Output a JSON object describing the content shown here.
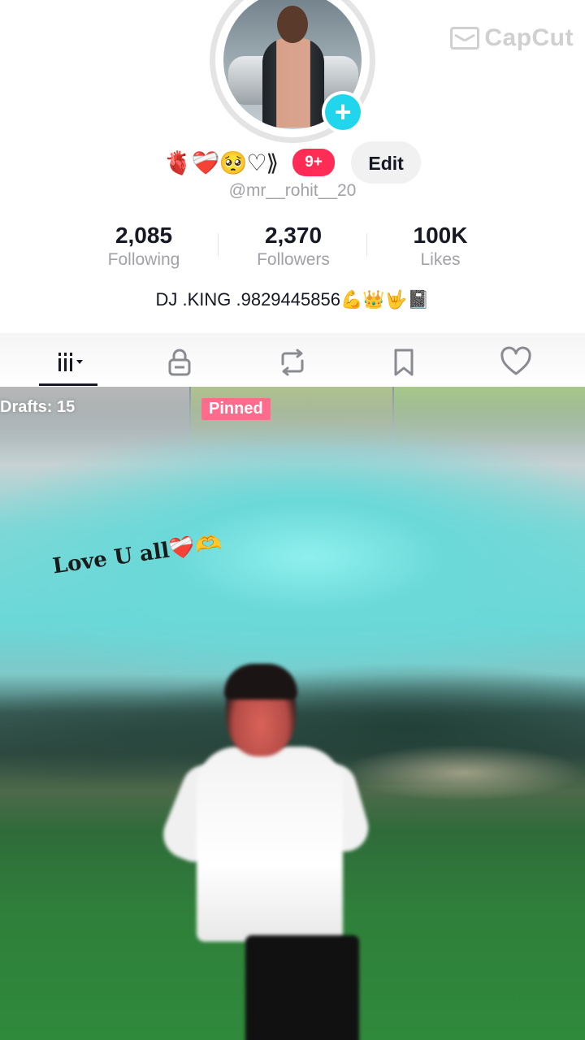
{
  "watermark": {
    "text": "CapCut"
  },
  "profile": {
    "avatar_alt": "profile photo",
    "add_icon": "plus-icon",
    "name_emojis": "🫀❤️‍🩹🥺♡⟫",
    "notification_badge": "9+",
    "edit_label": "Edit",
    "handle": "@mr__rohit__20",
    "stats": [
      {
        "value": "2,085",
        "label": "Following"
      },
      {
        "value": "2,370",
        "label": "Followers"
      },
      {
        "value": "100K",
        "label": "Likes"
      }
    ],
    "bio": "DJ .KING .9829445856💪👑🤟📓"
  },
  "tabs": [
    {
      "name": "videos",
      "icon": "grid-bars-icon",
      "selected": true
    },
    {
      "name": "private",
      "icon": "lock-icon",
      "selected": false
    },
    {
      "name": "reposts",
      "icon": "repost-icon",
      "selected": false
    },
    {
      "name": "favorites",
      "icon": "bookmark-icon",
      "selected": false
    },
    {
      "name": "liked",
      "icon": "heart-icon",
      "selected": false
    }
  ],
  "feed": {
    "drafts_label": "Drafts: 15",
    "pinned_label": "Pinned",
    "caption_text": "Love U all",
    "caption_emojis": "❤️‍🩹🫶"
  },
  "colors": {
    "accent_cyan": "#20d5ec",
    "badge_red": "#ff2c55",
    "pinned_pink": "#ff6b8c",
    "text_primary": "#161823",
    "text_secondary": "#a1a2a7"
  }
}
